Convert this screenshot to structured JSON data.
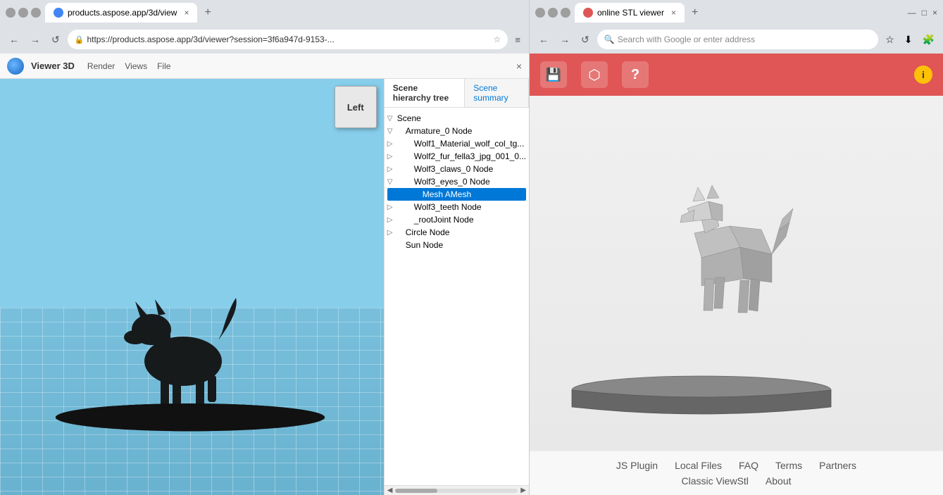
{
  "left_browser": {
    "tab_title": "products.aspose.app/3d/view",
    "tab_close": "×",
    "new_tab": "+",
    "nav": {
      "back": "←",
      "forward": "→",
      "refresh": "↺",
      "home": "⌂"
    },
    "address": "https://products.aspose.app/3d/viewer?session=3f6a947d-9153-...",
    "menu_btn": "≡",
    "star": "☆"
  },
  "viewer_app": {
    "title": "Viewer 3D",
    "menu_items": [
      "Render",
      "Views",
      "File"
    ],
    "close_btn": "×",
    "cube_label": "Left",
    "tabs": {
      "hierarchy": "Scene hierarchy tree",
      "summary": "Scene summary"
    },
    "tree": [
      {
        "label": "Scene",
        "indent": 0,
        "arrow": "▽",
        "type": "group"
      },
      {
        "label": "Armature_0 Node",
        "indent": 1,
        "arrow": "▽",
        "type": "group"
      },
      {
        "label": "Wolf1_Material_wolf_col_tg...",
        "indent": 2,
        "arrow": "▷",
        "type": "leaf"
      },
      {
        "label": "Wolf2_fur_fella3_jpg_001_0...",
        "indent": 2,
        "arrow": "▷",
        "type": "leaf"
      },
      {
        "label": "Wolf3_claws_0 Node",
        "indent": 2,
        "arrow": "▷",
        "type": "leaf"
      },
      {
        "label": "Wolf3_eyes_0 Node",
        "indent": 2,
        "arrow": "▽",
        "type": "group"
      },
      {
        "label": "Mesh AMesh",
        "indent": 3,
        "arrow": "",
        "type": "selected"
      },
      {
        "label": "Wolf3_teeth Node",
        "indent": 2,
        "arrow": "▷",
        "type": "leaf"
      },
      {
        "label": "_rootJoint Node",
        "indent": 2,
        "arrow": "▷",
        "type": "leaf"
      },
      {
        "label": "Circle Node",
        "indent": 1,
        "arrow": "▷",
        "type": "leaf"
      },
      {
        "label": "Sun Node",
        "indent": 1,
        "arrow": "",
        "type": "leaf"
      }
    ]
  },
  "right_browser": {
    "tab_title": "online STL viewer",
    "tab_close": "×",
    "new_tab": "+",
    "address": "Search with Google or enter address",
    "toolbar": {
      "save_icon": "💾",
      "cube_icon": "📦",
      "help_icon": "?",
      "info_icon": "i"
    }
  },
  "stl_footer": {
    "row1": [
      "JS Plugin",
      "Local Files",
      "FAQ",
      "Terms",
      "Partners"
    ],
    "row2": [
      "Classic ViewStl",
      "About"
    ]
  },
  "colors": {
    "stl_toolbar": "#e05555",
    "selected_node": "#0078d7",
    "sky_blue": "#87ceeb"
  }
}
